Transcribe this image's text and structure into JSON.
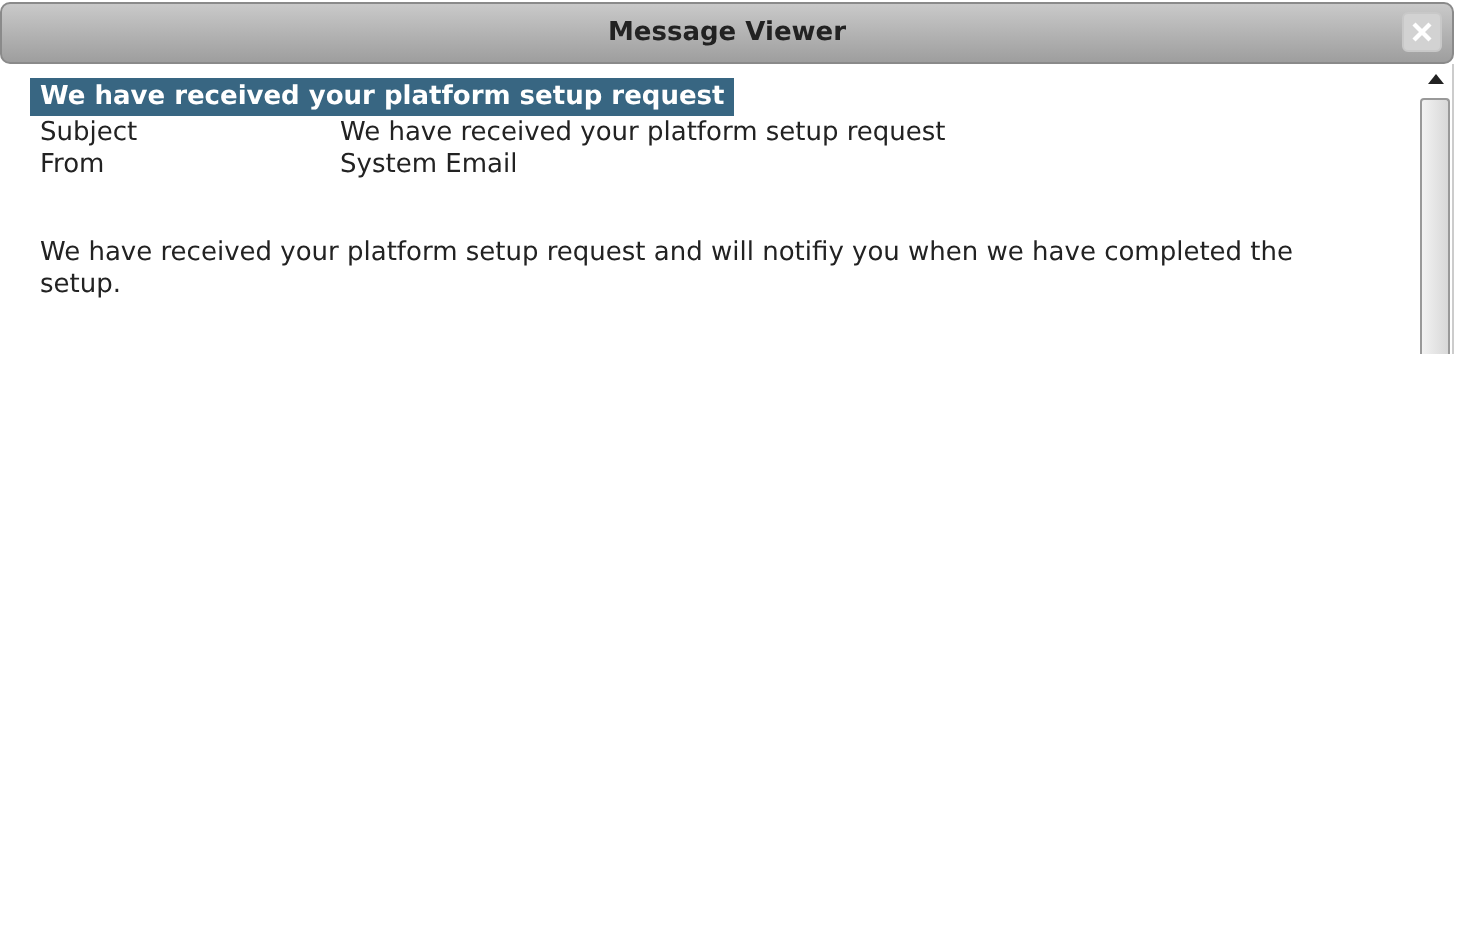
{
  "window": {
    "title": "Message Viewer",
    "close_disabled": true
  },
  "message": {
    "heading": "We have received your platform setup request",
    "fields": [
      {
        "label": "Subject",
        "value": "We have received your platform setup request"
      },
      {
        "label": "From",
        "value": "System Email"
      }
    ],
    "body": "We have received your platform setup request and will notifiy you when we have completed the setup."
  }
}
